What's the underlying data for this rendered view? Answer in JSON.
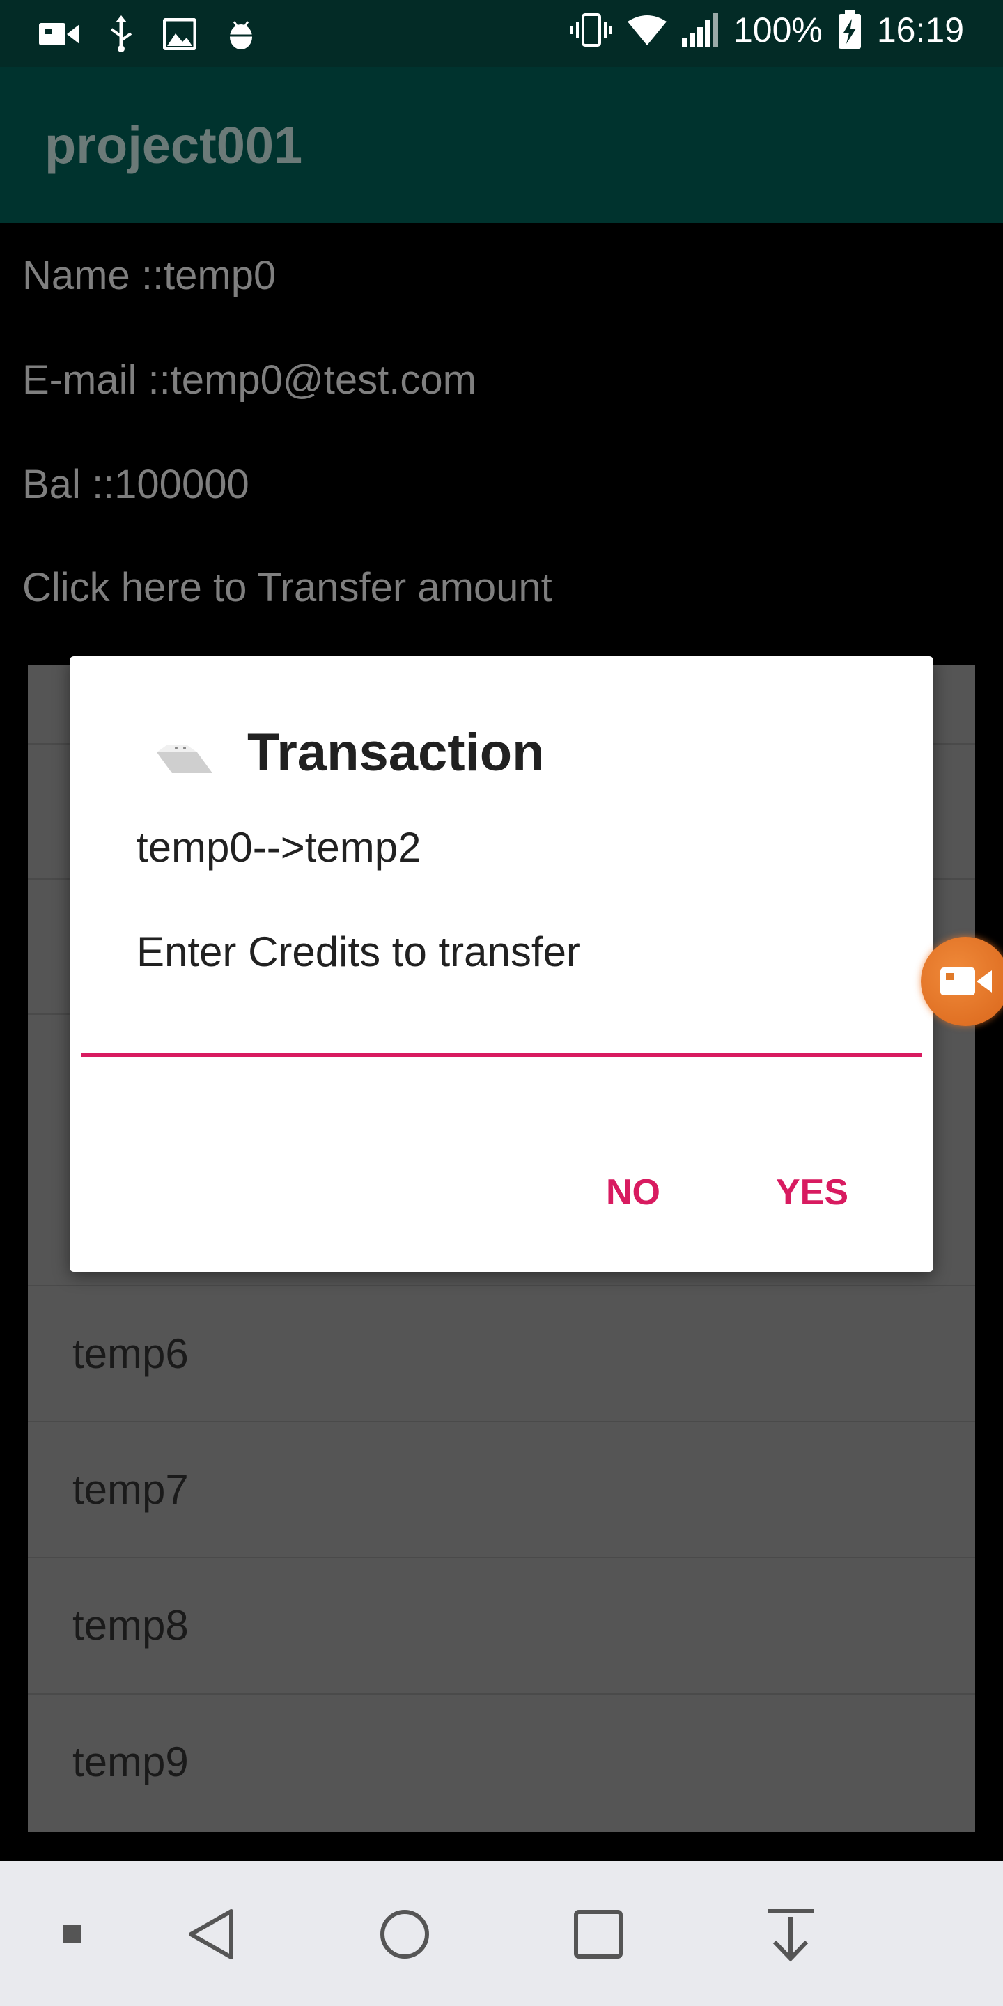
{
  "status_bar": {
    "left_icons": [
      "video-icon",
      "usb-icon",
      "image-icon",
      "android-debug-icon"
    ],
    "battery_percent": "100%",
    "time": "16:19"
  },
  "app_bar": {
    "title": "project001"
  },
  "profile": {
    "name": "Name  ::temp0",
    "email": "E-mail ::temp0@test.com",
    "balance": "Bal   ::100000",
    "transfer_link": "Click here to Transfer amount"
  },
  "list": {
    "items": [
      "temp6",
      "temp7",
      "temp8",
      "temp9"
    ]
  },
  "dialog": {
    "title": "Transaction",
    "route": "temp0-->temp2",
    "prompt": "Enter Credits to transfer",
    "input_value": "",
    "no_label": "NO",
    "yes_label": "YES"
  },
  "colors": {
    "status_bar": "#032b26",
    "app_bar": "#00332e",
    "accent": "#d81b60",
    "overlay_list": "#555555",
    "fab": "#e8761e"
  }
}
